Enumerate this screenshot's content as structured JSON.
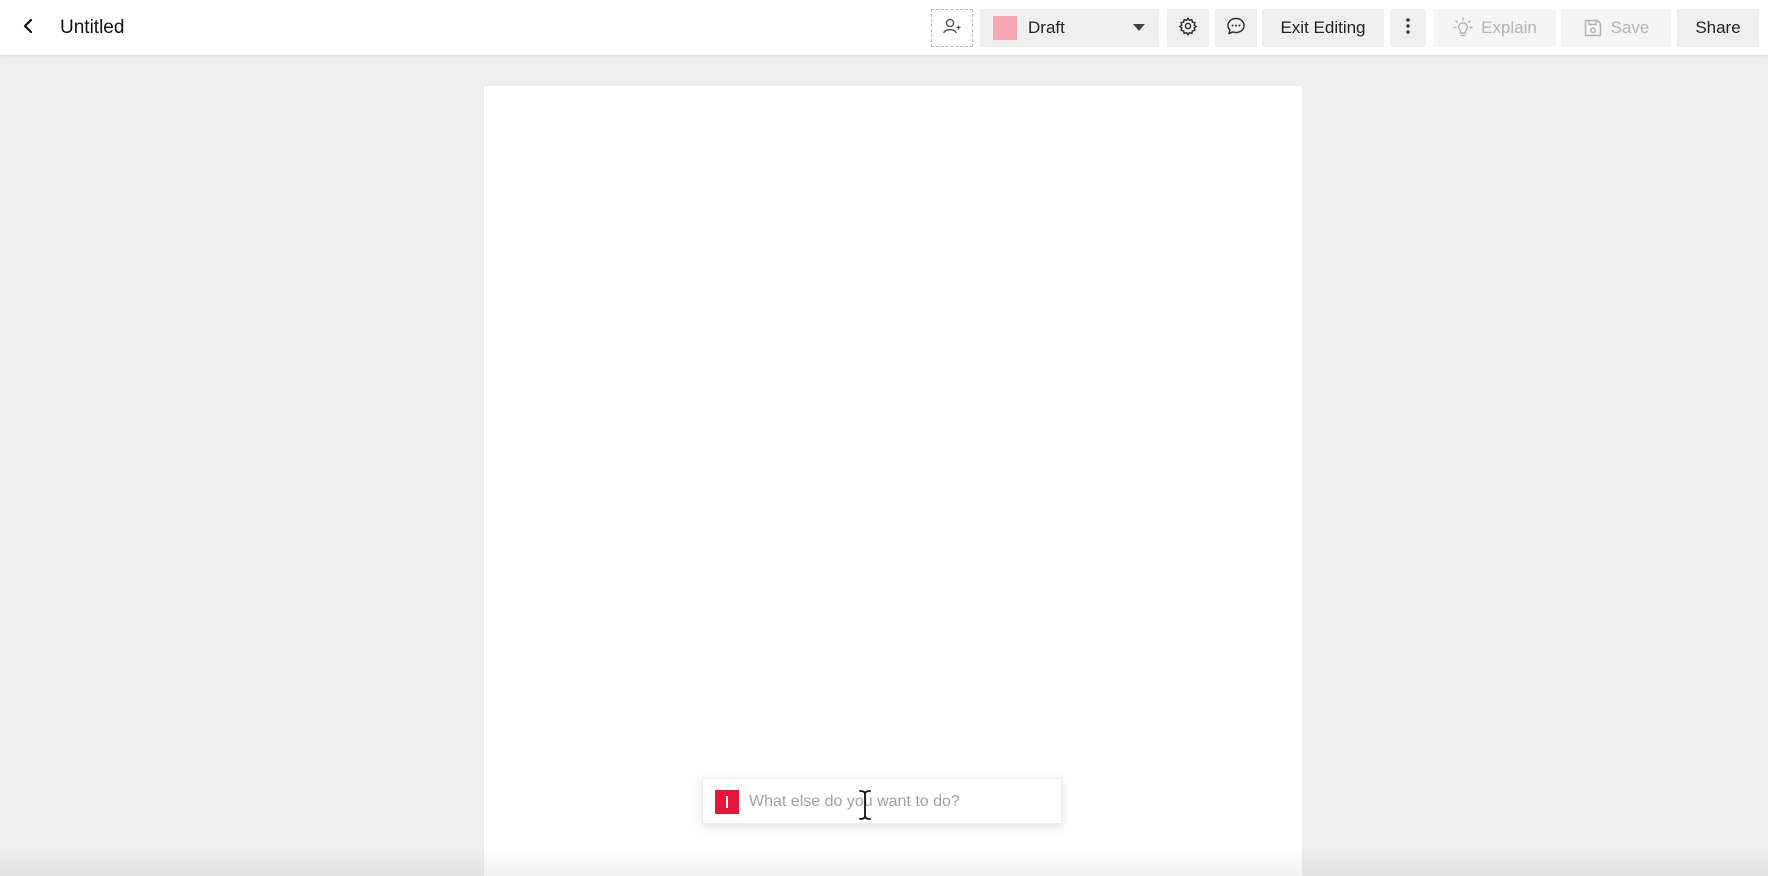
{
  "header": {
    "title": "Untitled",
    "back_icon": "chevron-left-icon"
  },
  "toolbar": {
    "add_collaborator_icon": "user-plus-icon",
    "status": {
      "label": "Draft",
      "swatch_color": "#f7a6b2",
      "dropdown_icon": "caret-down-icon"
    },
    "settings_icon": "gear-icon",
    "comments_icon": "speech-bubble-icon",
    "exit_label": "Exit Editing",
    "more_icon": "vertical-dots-icon",
    "explain_label": "Explain",
    "explain_icon": "lightbulb-icon",
    "save_label": "Save",
    "save_icon": "floppy-disk-icon",
    "share_label": "Share"
  },
  "prompt": {
    "placeholder": "What else do you want to do?",
    "value": "",
    "logo_color": "#e5163a"
  },
  "colors": {
    "background": "#efefef",
    "page": "#ffffff",
    "button_bg": "#efefef",
    "disabled_text": "#b4b4b4"
  }
}
